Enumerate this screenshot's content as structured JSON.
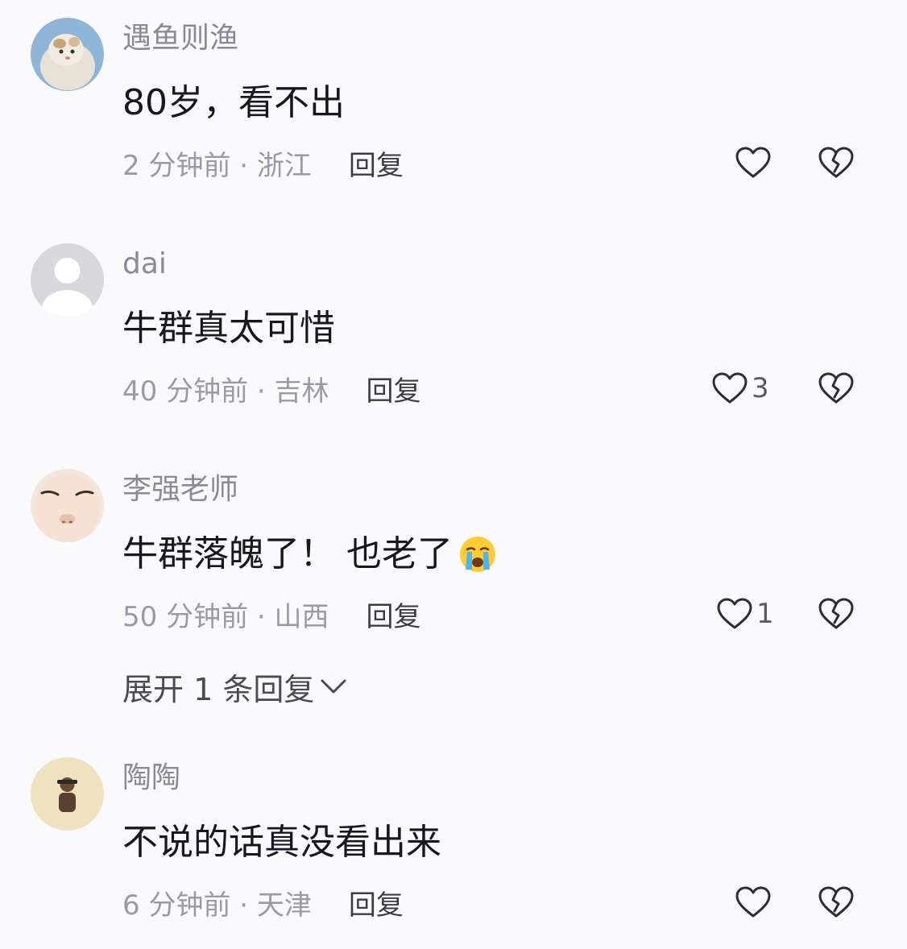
{
  "comments": [
    {
      "username": "遇鱼则渔",
      "text": "80岁，看不出",
      "meta": "2 分钟前 · 浙江",
      "reply_label": "回复",
      "like_count": "",
      "avatar": "cat-avatar"
    },
    {
      "username": "dai",
      "text": "牛群真太可惜",
      "meta": "40 分钟前 · 吉林",
      "reply_label": "回复",
      "like_count": "3",
      "avatar": "default-avatar"
    },
    {
      "username": "李强老师",
      "text": "牛群落魄了！ 也老了",
      "emoji": "crying-face-emoji",
      "meta": "50 分钟前 · 山西",
      "reply_label": "回复",
      "like_count": "1",
      "avatar": "face-avatar",
      "expand_label": "展开 1 条回复"
    },
    {
      "username": "陶陶",
      "text": "不说的话真没看出来",
      "meta": "6 分钟前 · 天津",
      "reply_label": "回复",
      "like_count": "",
      "avatar": "person-avatar"
    }
  ],
  "icons": {
    "like": "heart-outline-icon",
    "dislike": "broken-heart-icon",
    "expand": "chevron-down-icon"
  },
  "colors": {
    "background": "#fafafd",
    "username": "#8a8a96",
    "text": "#17171f",
    "meta": "#9a9aa6"
  }
}
